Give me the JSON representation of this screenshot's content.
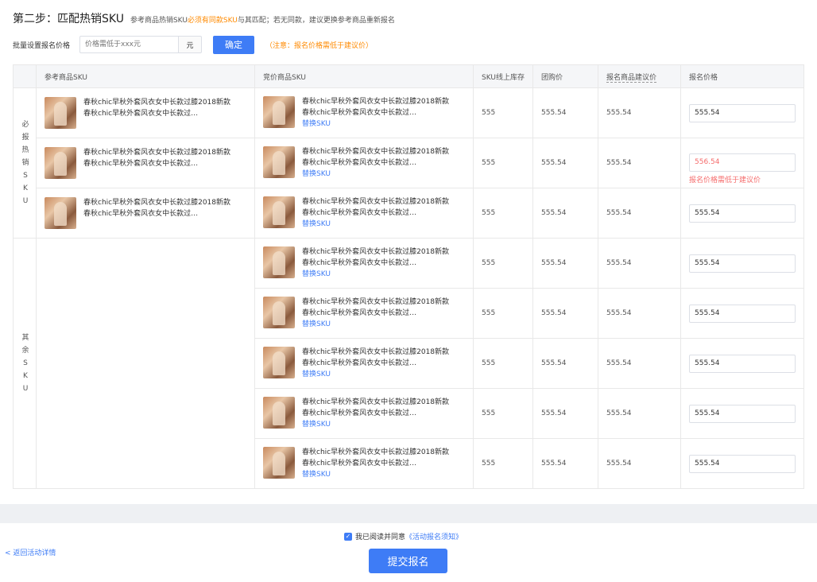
{
  "step": {
    "title": "第二步：匹配热销SKU",
    "desc_prefix": "参考商品热销SKU",
    "desc_highlight": "必须有同款SKU",
    "desc_suffix": "与其匹配；若无同款，建议更换参考商品重新报名"
  },
  "batch": {
    "label": "批量设置报名价格",
    "placeholder": "价格需低于xxx元",
    "unit": "元",
    "confirm_label": "确定",
    "note": "（注意：报名价格需低于建议价）"
  },
  "table": {
    "headers": [
      "",
      "参考商品SKU",
      "竞价商品SKU",
      "SKU线上库存",
      "团购价",
      "报名商品建议价",
      "报名价格"
    ],
    "groups": {
      "hot": "必报热销SKU",
      "other": "其余SKU"
    },
    "product_name": "春秋chic早秋外套风衣女中长款过膝2018新款春秋chic早秋外套风衣女中长款过…",
    "replace_label": "替换SKU",
    "rows": [
      {
        "stock": "555",
        "group_price": "555.54",
        "suggest_price": "555.54",
        "price": "555.54"
      },
      {
        "stock": "555",
        "group_price": "555.54",
        "suggest_price": "555.54",
        "price": "556.54",
        "error": "报名价格需低于建议价"
      },
      {
        "stock": "555",
        "group_price": "555.54",
        "suggest_price": "555.54",
        "price": "555.54"
      },
      {
        "stock": "555",
        "group_price": "555.54",
        "suggest_price": "555.54",
        "price": "555.54"
      },
      {
        "stock": "555",
        "group_price": "555.54",
        "suggest_price": "555.54",
        "price": "555.54"
      },
      {
        "stock": "555",
        "group_price": "555.54",
        "suggest_price": "555.54",
        "price": "555.54"
      },
      {
        "stock": "555",
        "group_price": "555.54",
        "suggest_price": "555.54",
        "price": "555.54"
      },
      {
        "stock": "555",
        "group_price": "555.54",
        "suggest_price": "555.54",
        "price": "555.54"
      }
    ]
  },
  "footer": {
    "back_label": "< 返回活动详情",
    "agree_text": "我已阅读并同意",
    "agree_link": "《活动报名须知》",
    "submit_label": "提交报名"
  }
}
